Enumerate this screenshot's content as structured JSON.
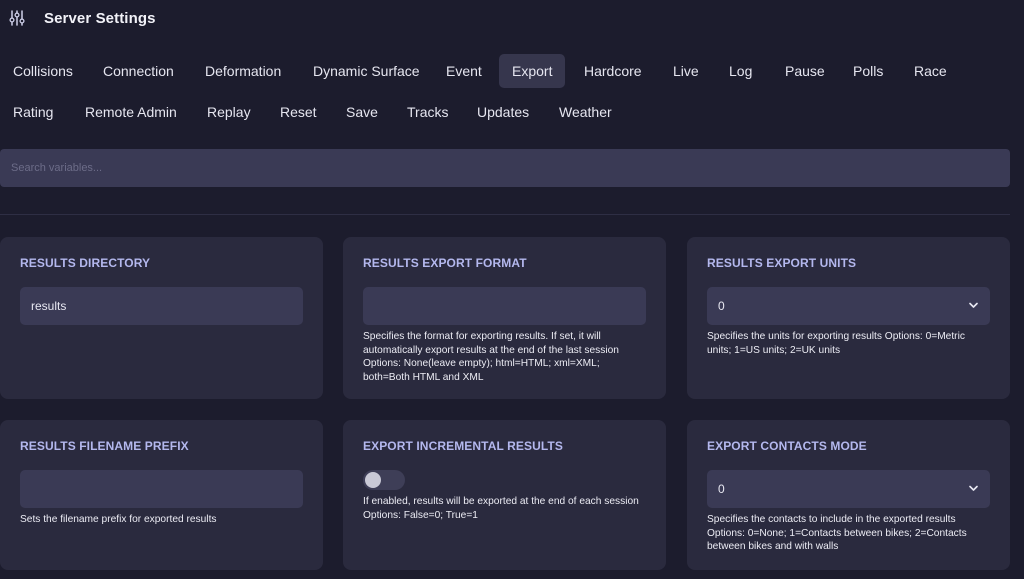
{
  "header": {
    "title": "Server Settings",
    "icon": "sliders-icon"
  },
  "tabs": [
    {
      "label": "Collisions"
    },
    {
      "label": "Connection"
    },
    {
      "label": "Deformation"
    },
    {
      "label": "Dynamic Surface"
    },
    {
      "label": "Event"
    },
    {
      "label": "Export"
    },
    {
      "label": "Hardcore"
    },
    {
      "label": "Live"
    },
    {
      "label": "Log"
    },
    {
      "label": "Pause"
    },
    {
      "label": "Polls"
    },
    {
      "label": "Race"
    },
    {
      "label": "Rating"
    },
    {
      "label": "Remote Admin"
    },
    {
      "label": "Replay"
    },
    {
      "label": "Reset"
    },
    {
      "label": "Save"
    },
    {
      "label": "Tracks"
    },
    {
      "label": "Updates"
    },
    {
      "label": "Weather"
    }
  ],
  "active_tab": "Export",
  "search": {
    "placeholder": "Search variables...",
    "value": ""
  },
  "cards": {
    "results_directory": {
      "title": "RESULTS DIRECTORY",
      "value": "results"
    },
    "results_export_format": {
      "title": "RESULTS EXPORT FORMAT",
      "value": "",
      "description": "Specifies the format for exporting results. If set, it will automatically export results at the end of the last session Options: None(leave empty); html=HTML; xml=XML; both=Both HTML and XML"
    },
    "results_export_units": {
      "title": "RESULTS EXPORT UNITS",
      "value": "0",
      "description": "Specifies the units for exporting results Options: 0=Metric units; 1=US units; 2=UK units"
    },
    "results_filename_prefix": {
      "title": "RESULTS FILENAME PREFIX",
      "value": "",
      "description": "Sets the filename prefix for exported results"
    },
    "export_incremental_results": {
      "title": "EXPORT INCREMENTAL RESULTS",
      "enabled": false,
      "description": "If enabled, results will be exported at the end of each session Options: False=0; True=1"
    },
    "export_contacts_mode": {
      "title": "EXPORT CONTACTS MODE",
      "value": "0",
      "description": "Specifies the contacts to include in the exported results Options: 0=None; 1=Contacts between bikes; 2=Contacts between bikes and with walls"
    }
  },
  "colors": {
    "background": "#1c1c2d",
    "card": "#2a2a3e",
    "field": "#3a3a55",
    "card_title": "#b4b8ee",
    "active_tab": "#36364d"
  }
}
